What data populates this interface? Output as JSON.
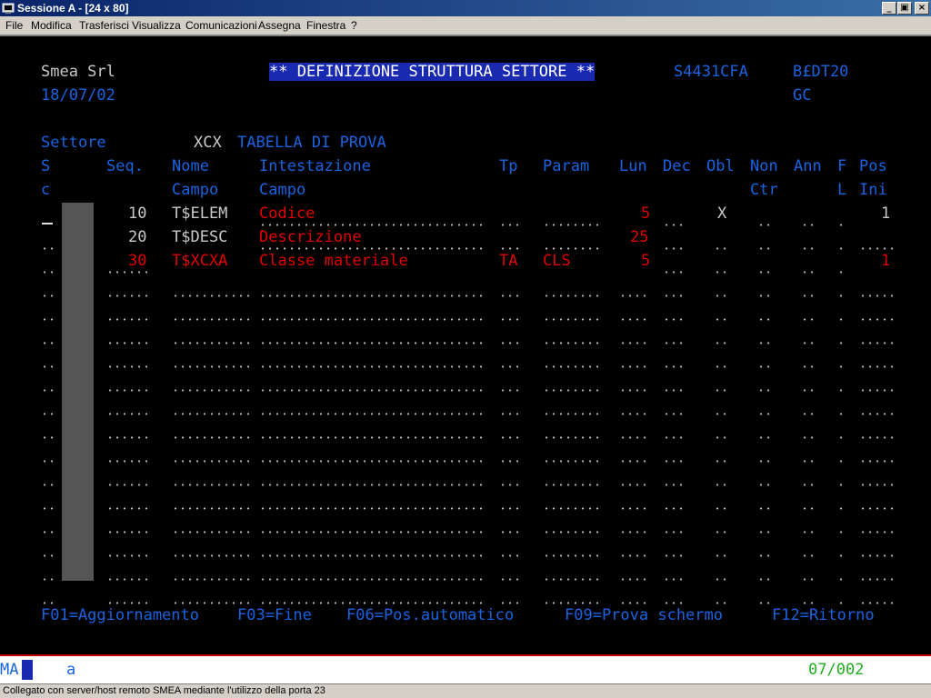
{
  "window": {
    "title": "Sessione A - [24 x 80]",
    "btn_min": "_",
    "btn_max": "ф",
    "btn_close": "×"
  },
  "menu": [
    "File",
    "Modifica",
    "Trasferisci",
    "Visualizza",
    "Comunicazioni",
    "Assegna",
    "Finestra",
    "?"
  ],
  "screen": {
    "company": "Smea Srl",
    "date": "18/07/02",
    "title": "** DEFINIZIONE STRUTTURA SETTORE **",
    "program": "S4431CFA",
    "code1": "B£DT20",
    "code2": "GC",
    "settore_label": "Settore",
    "settore_code": "XCX",
    "settore_desc": "TABELLA DI PROVA",
    "headers": {
      "s1": "S",
      "s2": "c",
      "seq": "Seq.",
      "nome1": "Nome",
      "nome2": "Campo",
      "int1": "Intestazione",
      "int2": "Campo",
      "tp": "Tp",
      "param": "Param",
      "lun": "Lun",
      "dec": "Dec",
      "obl": "Obl",
      "non1": "Non",
      "non2": "Ctr",
      "ann": "Ann",
      "f1": "F",
      "f2": "L",
      "pos1": "Pos",
      "pos2": "Ini"
    },
    "rows": [
      {
        "seq": "10",
        "nome": "T$ELEM",
        "intest": "Codice",
        "tp": "",
        "param": "",
        "lun": "5",
        "obl": "X",
        "pos": "1"
      },
      {
        "seq": "20",
        "nome": "T$DESC",
        "intest": "Descrizione",
        "tp": "",
        "param": "",
        "lun": "25",
        "obl": "",
        "pos": ""
      },
      {
        "seq": "30",
        "nome": "T$XCXA",
        "intest": "Classe materiale",
        "tp": "TA",
        "param": "CLS",
        "lun": "5",
        "obl": "",
        "pos": "1"
      }
    ],
    "fkeys": {
      "f01": "F01=Aggiornamento",
      "f03": "F03=Fine",
      "f06": "F06=Pos.automatico",
      "f09": "F09=Prova schermo",
      "f12": "F12=Ritorno"
    }
  },
  "oia": {
    "mode": "MA",
    "indicator": "a",
    "position": "07/002"
  },
  "status": {
    "text": "Collegato con server/host remoto SMEA mediante l'utilizzo della porta 23"
  }
}
